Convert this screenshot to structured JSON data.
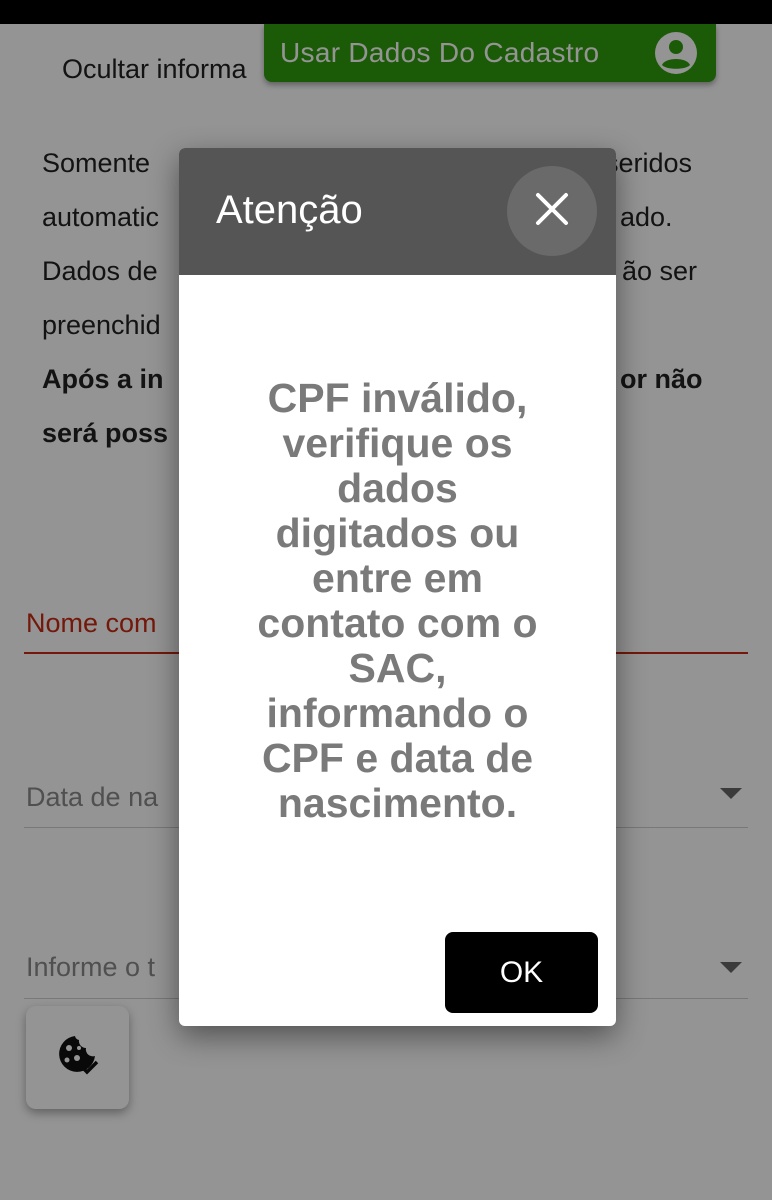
{
  "top_button": {
    "label": "Usar Dados Do Cadastro",
    "icon": "account-circle-icon"
  },
  "hide_info": {
    "label": "Ocultar informa"
  },
  "notice": {
    "lines": [
      "Somente",
      "automatic",
      "Dados de",
      "preenchid"
    ],
    "right_fragments": [
      "inseridos",
      "ado.",
      "ão ser"
    ],
    "bold_lines": [
      "Após a in",
      "será poss"
    ],
    "bold_right_fragment": "or não"
  },
  "form": {
    "name_label": "Nome com",
    "birth_label": "Data de na",
    "type_label": "Informe o t"
  },
  "cookie_button": {
    "icon": "cookie-settings-icon"
  },
  "modal": {
    "title": "Atenção",
    "message_lines": [
      "CPF inválido,",
      "verifique os",
      "dados",
      "digitados ou",
      "entre em",
      "contato com o",
      "SAC,",
      "informando o",
      "CPF e data de",
      "nascimento."
    ],
    "ok_label": "OK"
  },
  "colors": {
    "green": "#2f9d0f",
    "error_red": "#c62a12",
    "header_gray": "#555555"
  }
}
